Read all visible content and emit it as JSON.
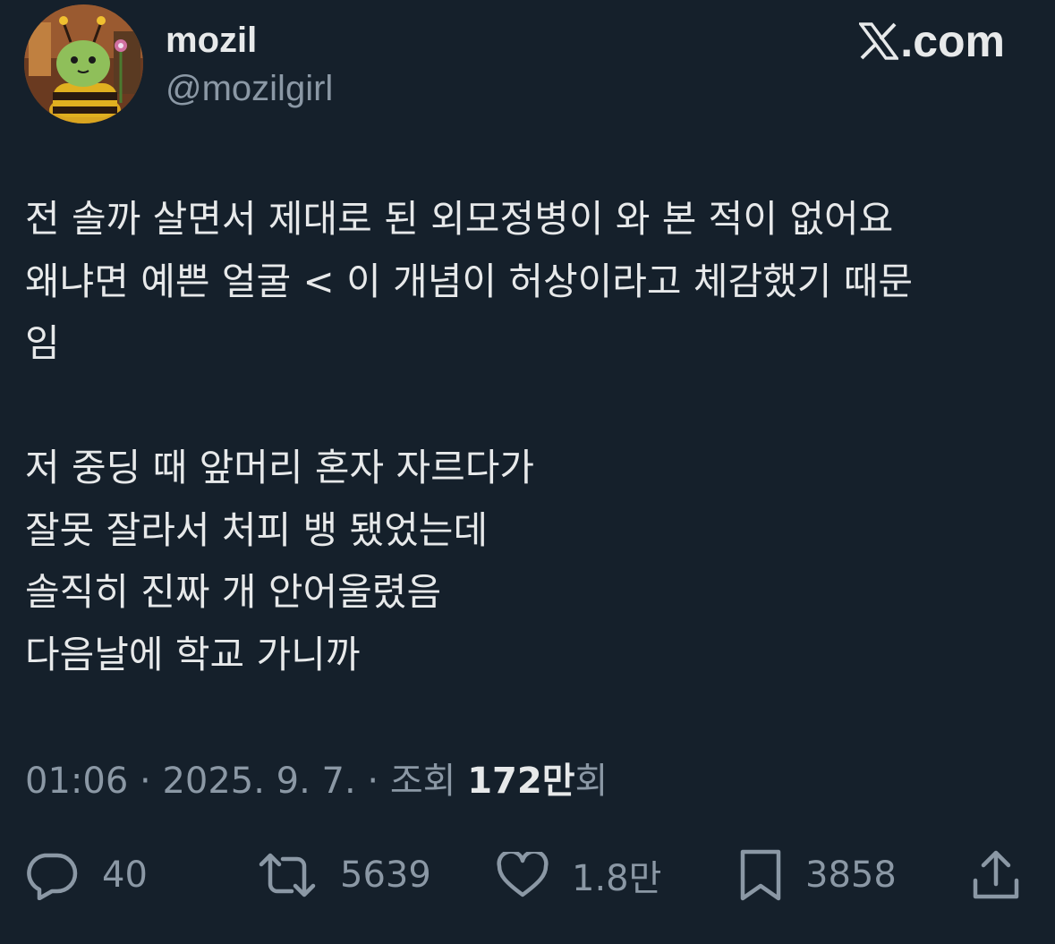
{
  "header": {
    "display_name": "mozil",
    "handle": "@mozilgirl",
    "brand": ".com",
    "brand_logo_icon": "x-logo-icon"
  },
  "tweet": {
    "lines": [
      "전 솔까 살면서 제대로 된 외모정병이 와 본 적이 없어요",
      "왜냐면 예쁜 얼굴 < 이 개념이 허상이라고 체감했기 때문",
      "임",
      "",
      "저 중딩 때 앞머리 혼자 자르다가",
      "잘못 잘라서 처피 뱅 됐었는데",
      "솔직히 진짜 개 안어울렸음",
      "다음날에 학교 가니까"
    ]
  },
  "meta": {
    "time": "01:06",
    "separator": " · ",
    "date": "2025. 9. 7.",
    "views_label": "조회",
    "views_count": "172만",
    "views_suffix": "회"
  },
  "actions": {
    "reply": {
      "icon": "reply-icon",
      "count": "40"
    },
    "retweet": {
      "icon": "retweet-icon",
      "count": "5639"
    },
    "like": {
      "icon": "heart-icon",
      "count": "1.8만"
    },
    "bookmark": {
      "icon": "bookmark-icon",
      "count": "3858"
    },
    "share": {
      "icon": "share-icon"
    }
  },
  "colors": {
    "background": "#15202b",
    "primary_text": "#e7e9ea",
    "secondary_text": "#8b98a5"
  }
}
